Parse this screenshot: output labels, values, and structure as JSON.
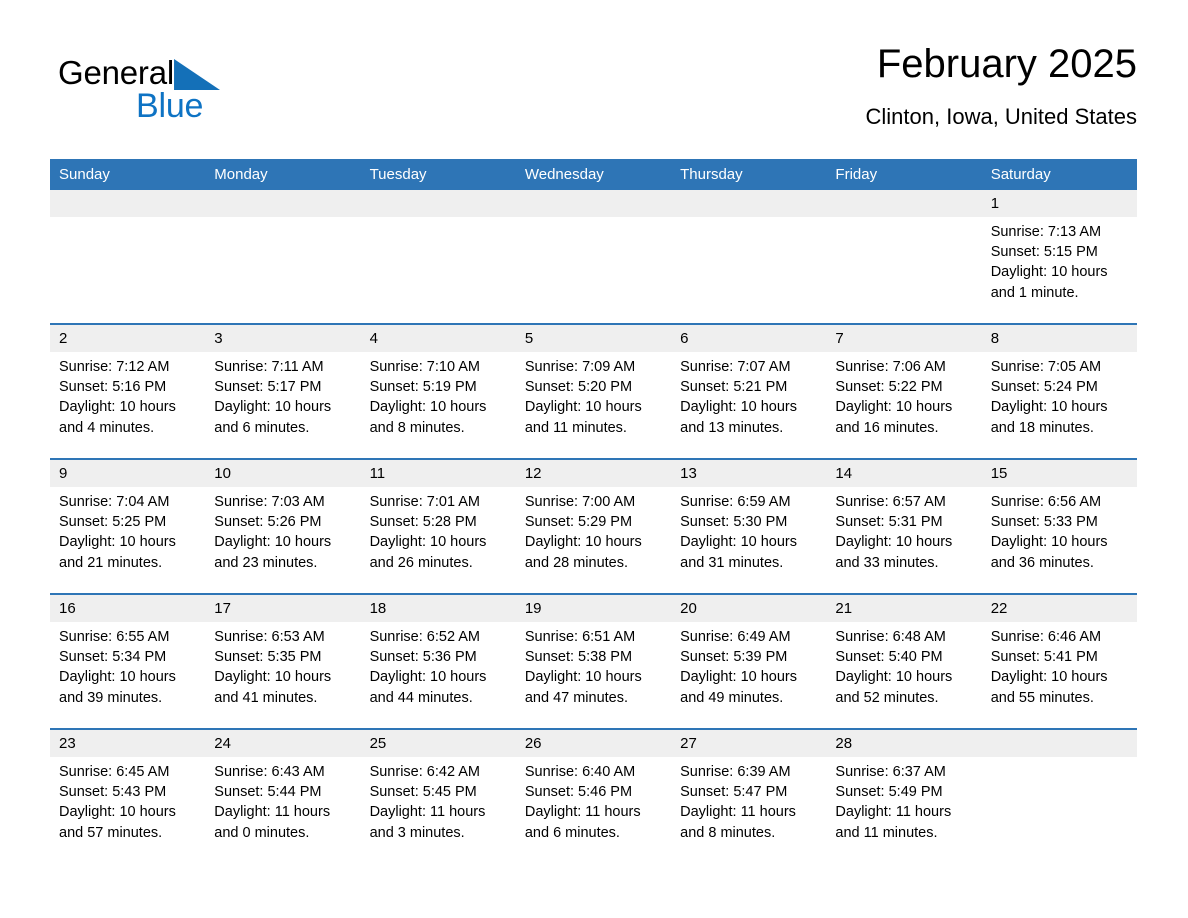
{
  "brand": {
    "name_part1": "General",
    "name_part2": "Blue",
    "triangle_icon": "triangle-icon",
    "color_black": "#000000",
    "color_blue": "#0e73c4"
  },
  "header": {
    "title": "February 2025",
    "subtitle": "Clinton, Iowa, United States"
  },
  "theme": {
    "header_bg": "#2e75b6",
    "header_text": "#ffffff",
    "daynum_band_bg": "#efefef",
    "row_divider": "#2e75b6",
    "page_bg": "#ffffff"
  },
  "weekdays": [
    "Sunday",
    "Monday",
    "Tuesday",
    "Wednesday",
    "Thursday",
    "Friday",
    "Saturday"
  ],
  "weeks": [
    [
      {
        "day": "",
        "sunrise": "",
        "sunset": "",
        "daylight_line1": "",
        "daylight_line2": ""
      },
      {
        "day": "",
        "sunrise": "",
        "sunset": "",
        "daylight_line1": "",
        "daylight_line2": ""
      },
      {
        "day": "",
        "sunrise": "",
        "sunset": "",
        "daylight_line1": "",
        "daylight_line2": ""
      },
      {
        "day": "",
        "sunrise": "",
        "sunset": "",
        "daylight_line1": "",
        "daylight_line2": ""
      },
      {
        "day": "",
        "sunrise": "",
        "sunset": "",
        "daylight_line1": "",
        "daylight_line2": ""
      },
      {
        "day": "",
        "sunrise": "",
        "sunset": "",
        "daylight_line1": "",
        "daylight_line2": ""
      },
      {
        "day": "1",
        "sunrise": "Sunrise: 7:13 AM",
        "sunset": "Sunset: 5:15 PM",
        "daylight_line1": "Daylight: 10 hours",
        "daylight_line2": "and 1 minute."
      }
    ],
    [
      {
        "day": "2",
        "sunrise": "Sunrise: 7:12 AM",
        "sunset": "Sunset: 5:16 PM",
        "daylight_line1": "Daylight: 10 hours",
        "daylight_line2": "and 4 minutes."
      },
      {
        "day": "3",
        "sunrise": "Sunrise: 7:11 AM",
        "sunset": "Sunset: 5:17 PM",
        "daylight_line1": "Daylight: 10 hours",
        "daylight_line2": "and 6 minutes."
      },
      {
        "day": "4",
        "sunrise": "Sunrise: 7:10 AM",
        "sunset": "Sunset: 5:19 PM",
        "daylight_line1": "Daylight: 10 hours",
        "daylight_line2": "and 8 minutes."
      },
      {
        "day": "5",
        "sunrise": "Sunrise: 7:09 AM",
        "sunset": "Sunset: 5:20 PM",
        "daylight_line1": "Daylight: 10 hours",
        "daylight_line2": "and 11 minutes."
      },
      {
        "day": "6",
        "sunrise": "Sunrise: 7:07 AM",
        "sunset": "Sunset: 5:21 PM",
        "daylight_line1": "Daylight: 10 hours",
        "daylight_line2": "and 13 minutes."
      },
      {
        "day": "7",
        "sunrise": "Sunrise: 7:06 AM",
        "sunset": "Sunset: 5:22 PM",
        "daylight_line1": "Daylight: 10 hours",
        "daylight_line2": "and 16 minutes."
      },
      {
        "day": "8",
        "sunrise": "Sunrise: 7:05 AM",
        "sunset": "Sunset: 5:24 PM",
        "daylight_line1": "Daylight: 10 hours",
        "daylight_line2": "and 18 minutes."
      }
    ],
    [
      {
        "day": "9",
        "sunrise": "Sunrise: 7:04 AM",
        "sunset": "Sunset: 5:25 PM",
        "daylight_line1": "Daylight: 10 hours",
        "daylight_line2": "and 21 minutes."
      },
      {
        "day": "10",
        "sunrise": "Sunrise: 7:03 AM",
        "sunset": "Sunset: 5:26 PM",
        "daylight_line1": "Daylight: 10 hours",
        "daylight_line2": "and 23 minutes."
      },
      {
        "day": "11",
        "sunrise": "Sunrise: 7:01 AM",
        "sunset": "Sunset: 5:28 PM",
        "daylight_line1": "Daylight: 10 hours",
        "daylight_line2": "and 26 minutes."
      },
      {
        "day": "12",
        "sunrise": "Sunrise: 7:00 AM",
        "sunset": "Sunset: 5:29 PM",
        "daylight_line1": "Daylight: 10 hours",
        "daylight_line2": "and 28 minutes."
      },
      {
        "day": "13",
        "sunrise": "Sunrise: 6:59 AM",
        "sunset": "Sunset: 5:30 PM",
        "daylight_line1": "Daylight: 10 hours",
        "daylight_line2": "and 31 minutes."
      },
      {
        "day": "14",
        "sunrise": "Sunrise: 6:57 AM",
        "sunset": "Sunset: 5:31 PM",
        "daylight_line1": "Daylight: 10 hours",
        "daylight_line2": "and 33 minutes."
      },
      {
        "day": "15",
        "sunrise": "Sunrise: 6:56 AM",
        "sunset": "Sunset: 5:33 PM",
        "daylight_line1": "Daylight: 10 hours",
        "daylight_line2": "and 36 minutes."
      }
    ],
    [
      {
        "day": "16",
        "sunrise": "Sunrise: 6:55 AM",
        "sunset": "Sunset: 5:34 PM",
        "daylight_line1": "Daylight: 10 hours",
        "daylight_line2": "and 39 minutes."
      },
      {
        "day": "17",
        "sunrise": "Sunrise: 6:53 AM",
        "sunset": "Sunset: 5:35 PM",
        "daylight_line1": "Daylight: 10 hours",
        "daylight_line2": "and 41 minutes."
      },
      {
        "day": "18",
        "sunrise": "Sunrise: 6:52 AM",
        "sunset": "Sunset: 5:36 PM",
        "daylight_line1": "Daylight: 10 hours",
        "daylight_line2": "and 44 minutes."
      },
      {
        "day": "19",
        "sunrise": "Sunrise: 6:51 AM",
        "sunset": "Sunset: 5:38 PM",
        "daylight_line1": "Daylight: 10 hours",
        "daylight_line2": "and 47 minutes."
      },
      {
        "day": "20",
        "sunrise": "Sunrise: 6:49 AM",
        "sunset": "Sunset: 5:39 PM",
        "daylight_line1": "Daylight: 10 hours",
        "daylight_line2": "and 49 minutes."
      },
      {
        "day": "21",
        "sunrise": "Sunrise: 6:48 AM",
        "sunset": "Sunset: 5:40 PM",
        "daylight_line1": "Daylight: 10 hours",
        "daylight_line2": "and 52 minutes."
      },
      {
        "day": "22",
        "sunrise": "Sunrise: 6:46 AM",
        "sunset": "Sunset: 5:41 PM",
        "daylight_line1": "Daylight: 10 hours",
        "daylight_line2": "and 55 minutes."
      }
    ],
    [
      {
        "day": "23",
        "sunrise": "Sunrise: 6:45 AM",
        "sunset": "Sunset: 5:43 PM",
        "daylight_line1": "Daylight: 10 hours",
        "daylight_line2": "and 57 minutes."
      },
      {
        "day": "24",
        "sunrise": "Sunrise: 6:43 AM",
        "sunset": "Sunset: 5:44 PM",
        "daylight_line1": "Daylight: 11 hours",
        "daylight_line2": "and 0 minutes."
      },
      {
        "day": "25",
        "sunrise": "Sunrise: 6:42 AM",
        "sunset": "Sunset: 5:45 PM",
        "daylight_line1": "Daylight: 11 hours",
        "daylight_line2": "and 3 minutes."
      },
      {
        "day": "26",
        "sunrise": "Sunrise: 6:40 AM",
        "sunset": "Sunset: 5:46 PM",
        "daylight_line1": "Daylight: 11 hours",
        "daylight_line2": "and 6 minutes."
      },
      {
        "day": "27",
        "sunrise": "Sunrise: 6:39 AM",
        "sunset": "Sunset: 5:47 PM",
        "daylight_line1": "Daylight: 11 hours",
        "daylight_line2": "and 8 minutes."
      },
      {
        "day": "28",
        "sunrise": "Sunrise: 6:37 AM",
        "sunset": "Sunset: 5:49 PM",
        "daylight_line1": "Daylight: 11 hours",
        "daylight_line2": "and 11 minutes."
      },
      {
        "day": "",
        "sunrise": "",
        "sunset": "",
        "daylight_line1": "",
        "daylight_line2": ""
      }
    ]
  ]
}
